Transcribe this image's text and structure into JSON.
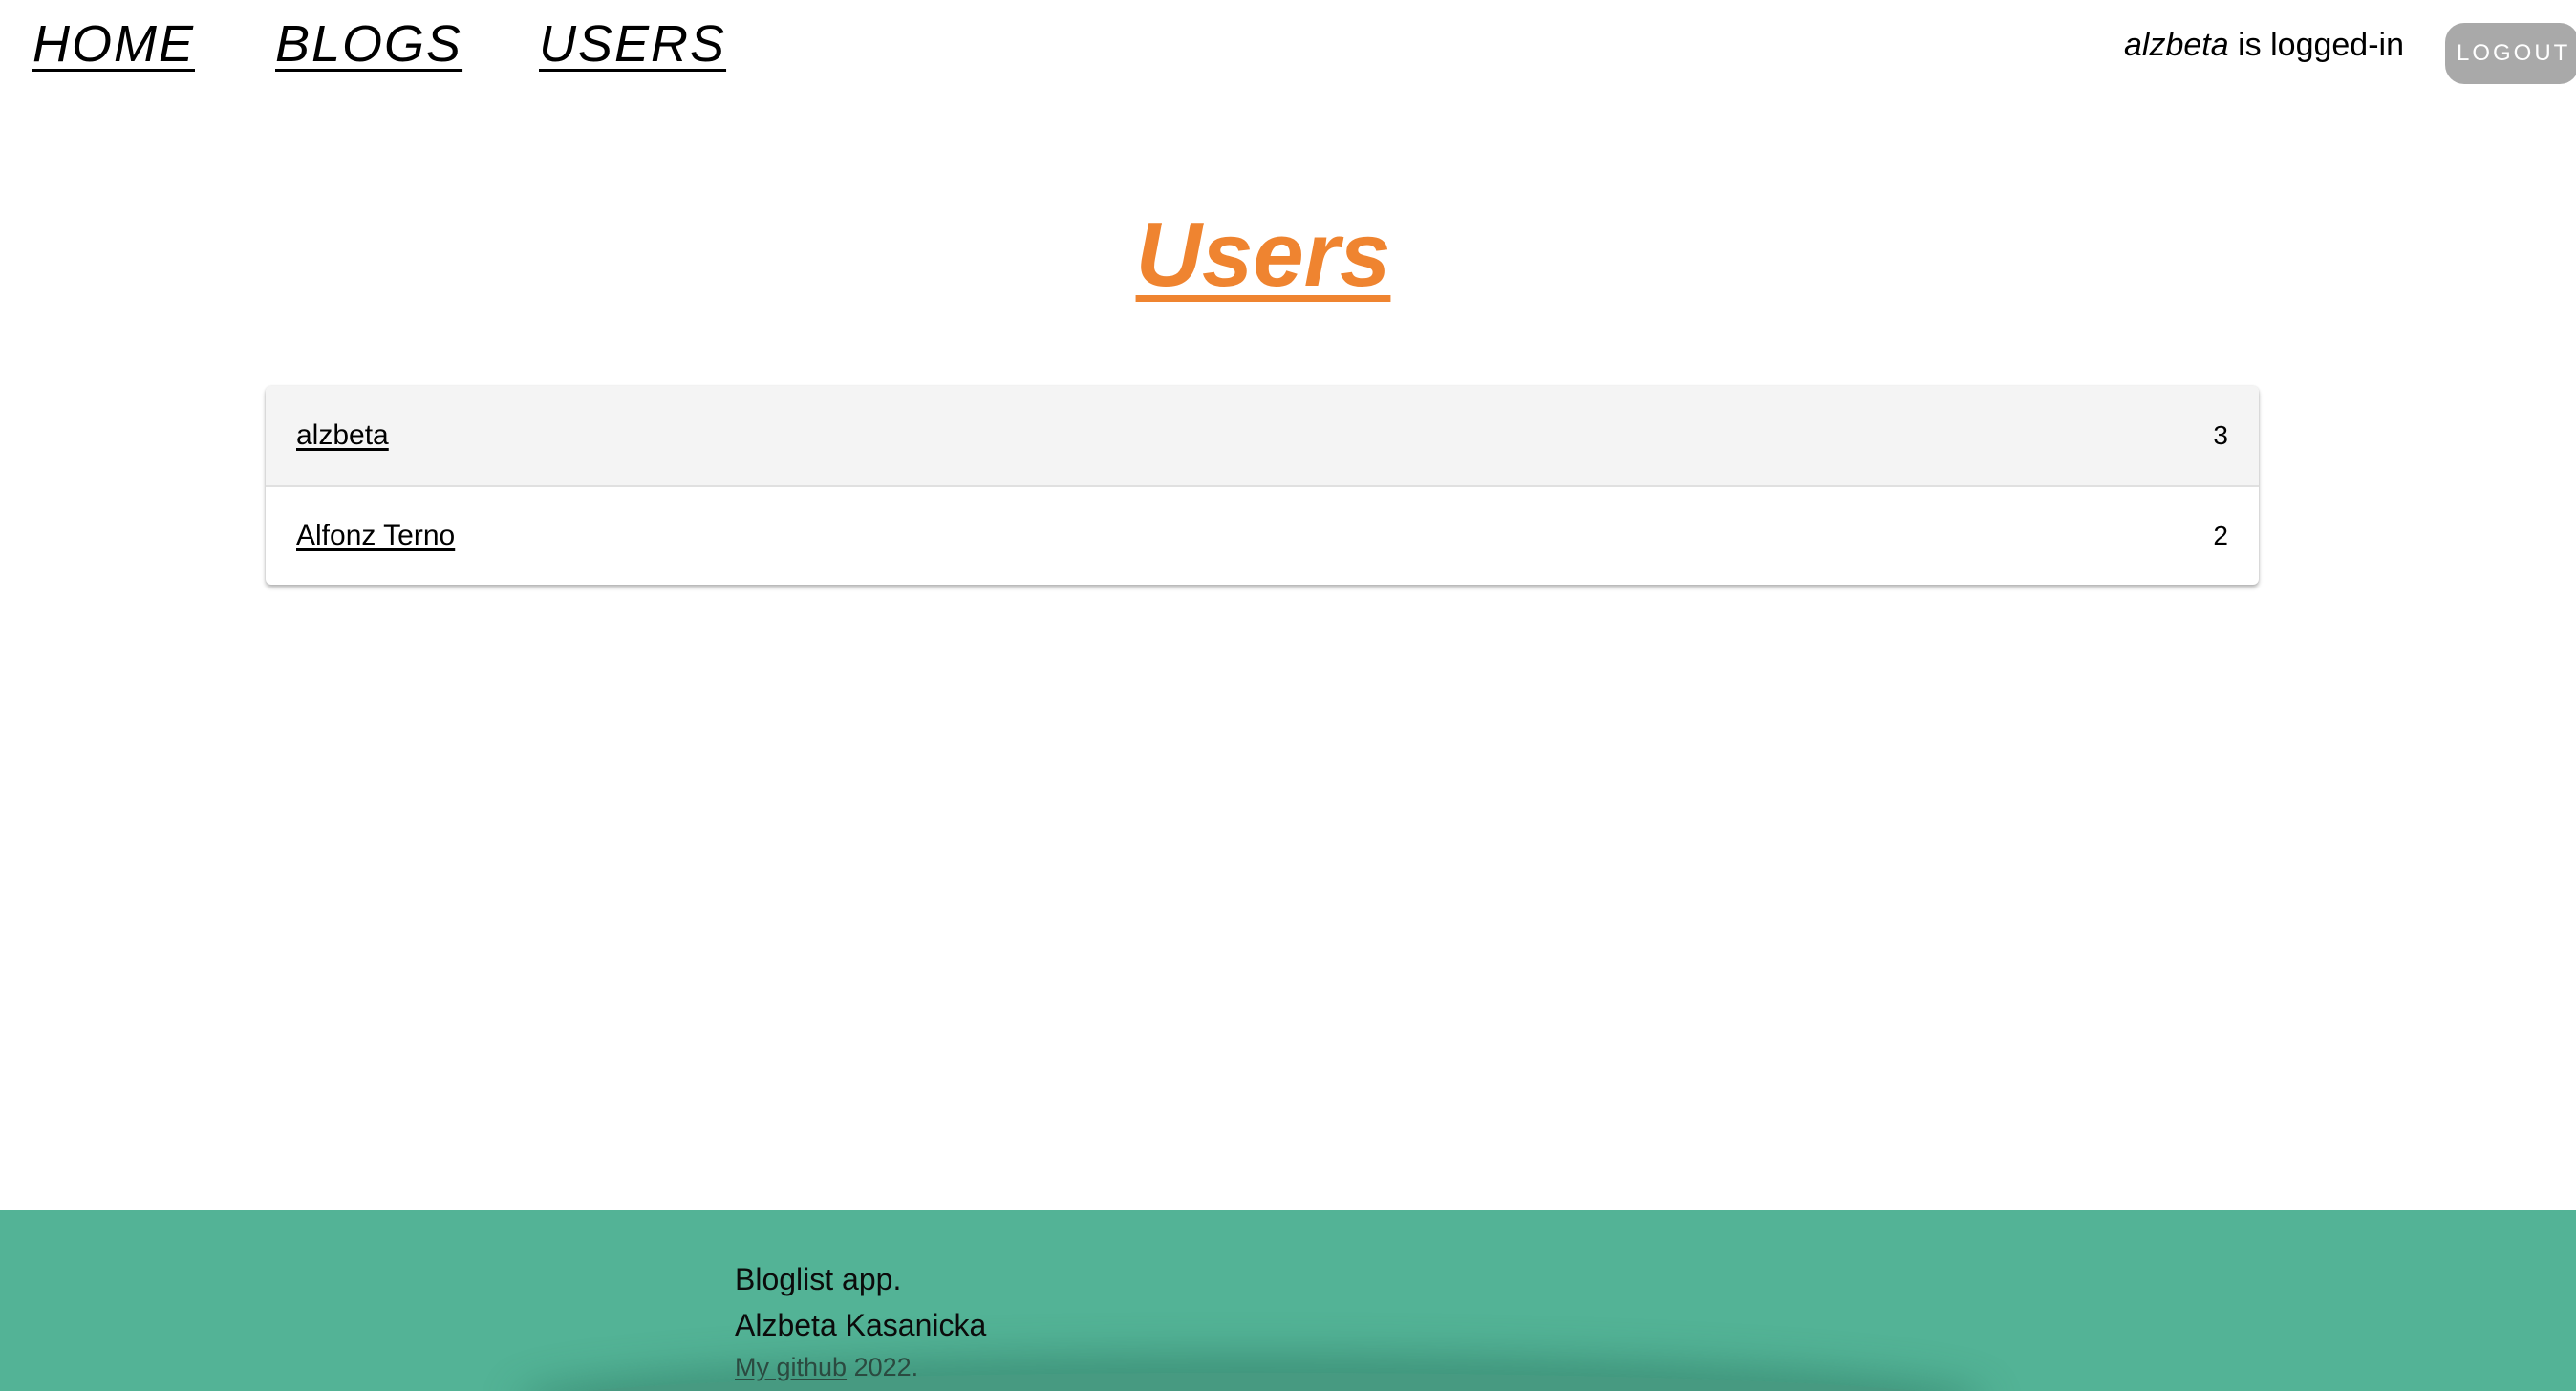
{
  "nav": {
    "home": "HOME",
    "blogs": "BLOGS",
    "users": "USERS"
  },
  "session": {
    "username": "alzbeta",
    "status_suffix": " is logged-in",
    "logout_label": "LOGOUT"
  },
  "page": {
    "title": "Users"
  },
  "users": [
    {
      "name": "alzbeta",
      "blogs": "3"
    },
    {
      "name": "Alfonz Terno",
      "blogs": "2"
    }
  ],
  "footer": {
    "line1": "Bloglist app.",
    "line2": "Alzbeta Kasanicka",
    "github_label": "My github",
    "year_suffix": " 2022."
  },
  "colors": {
    "title": "#ef8430",
    "footer_bg": "#53b396",
    "logout_bg": "#a9a9a9"
  }
}
